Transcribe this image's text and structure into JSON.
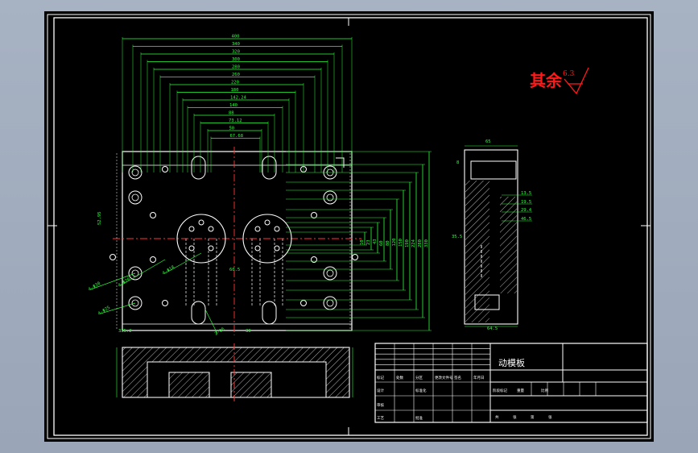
{
  "drawing": {
    "roughness_label": "其余",
    "roughness_value": "6.3",
    "part_name": "动模板",
    "colors": {
      "background": "#000000",
      "outline": "#ffffff",
      "dimension": "#33ff33",
      "centerline": "#ff3333",
      "annotation": "#ff0000",
      "sheet_bg": "#a0abbd"
    },
    "plan_dims_horizontal": [
      "400",
      "340",
      "320",
      "300",
      "280",
      "260",
      "220",
      "180",
      "142.24",
      "140",
      "88",
      "73.12",
      "50",
      "67.68"
    ],
    "plan_dims_vertical": [
      "330",
      "280",
      "224",
      "190",
      "150",
      "120",
      "80",
      "60",
      "43",
      "23",
      "10"
    ],
    "side_dims": [
      "8",
      "13.5",
      "19.5",
      "29.4",
      "46.5",
      "35.5",
      "65",
      "64.5"
    ],
    "hole_callouts": [
      "4-Φ30",
      "4-Φ25",
      "4-Φ20",
      "4-Φ18",
      "2-Φ6"
    ],
    "misc_dims": [
      "335.2",
      "52.95",
      "60.5",
      "30"
    ],
    "title_block": {
      "row_labels": [
        "标记",
        "处数",
        "分区",
        "更改文件号",
        "签名",
        "年月日"
      ],
      "design_label": "设计",
      "check_label": "审核",
      "std_label": "标准化",
      "process_label": "工艺",
      "approve_label": "批准",
      "stage_labels": [
        "阶段标记",
        "重量",
        "比例"
      ],
      "sheet_labels": [
        "共",
        "张",
        "第",
        "张"
      ]
    }
  }
}
